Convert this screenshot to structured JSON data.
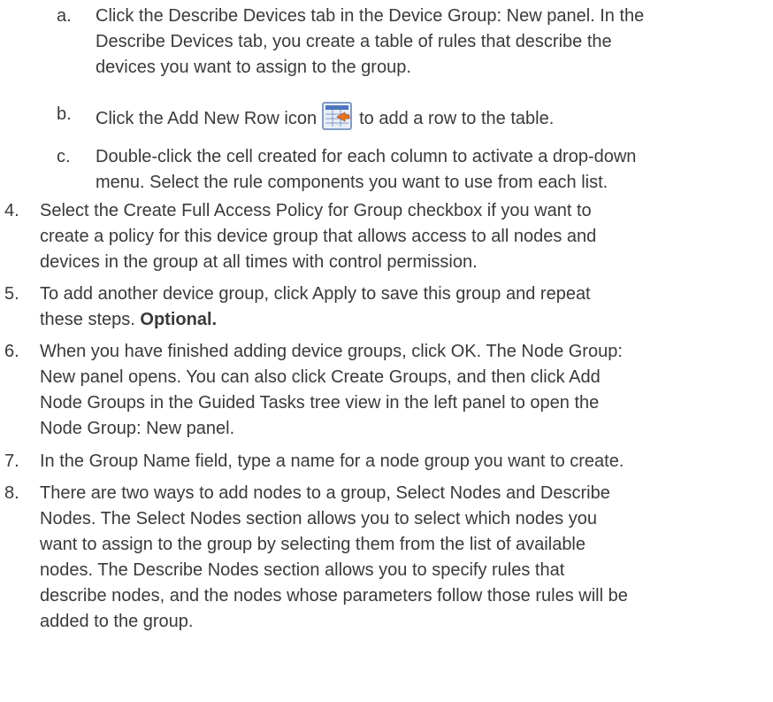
{
  "sub_a": {
    "marker": "a.",
    "lines": [
      "Click the Describe Devices tab in the Device Group: New panel. In the",
      "Describe Devices tab, you create a table of rules that describe the",
      "devices you want to assign to the group."
    ]
  },
  "sub_b": {
    "marker": "b.",
    "before": "Click the Add New Row icon",
    "after": "to add a row to the table.",
    "icon": "add-new-row-icon"
  },
  "sub_c": {
    "marker": "c.",
    "lines": [
      "Double-click the cell created for each column to activate a drop-down",
      "menu. Select the rule components you want to use from each list."
    ]
  },
  "step4": {
    "marker": "4.",
    "lines": [
      "Select the Create Full Access Policy for Group checkbox if you want to",
      "create a policy for this device group that allows access to all nodes and",
      "devices in the group at all times with control permission."
    ]
  },
  "step5": {
    "marker": "5.",
    "line1": "To add another device group, click Apply to save this group and repeat",
    "line2_text": "these steps.",
    "line2_bold": "Optional."
  },
  "step6": {
    "marker": "6.",
    "lines": [
      "When you have finished adding device groups, click OK. The Node Group:",
      "New panel opens. You can also click Create Groups, and then click Add",
      "Node Groups in the Guided Tasks tree view in the left panel to open the",
      "Node Group: New panel."
    ]
  },
  "step7": {
    "marker": "7.",
    "lines": [
      "In the Group Name field, type a name for a node group you want to create."
    ]
  },
  "step8": {
    "marker": "8.",
    "lines": [
      "There are two ways to add nodes to a group, Select Nodes and Describe",
      "Nodes. The Select Nodes section allows you to select which nodes you",
      "want to assign to the group by selecting them from the list of available",
      "nodes. The Describe Nodes section allows you to specify rules that",
      "describe nodes, and the nodes whose parameters follow those rules will be",
      "added to the group."
    ]
  }
}
